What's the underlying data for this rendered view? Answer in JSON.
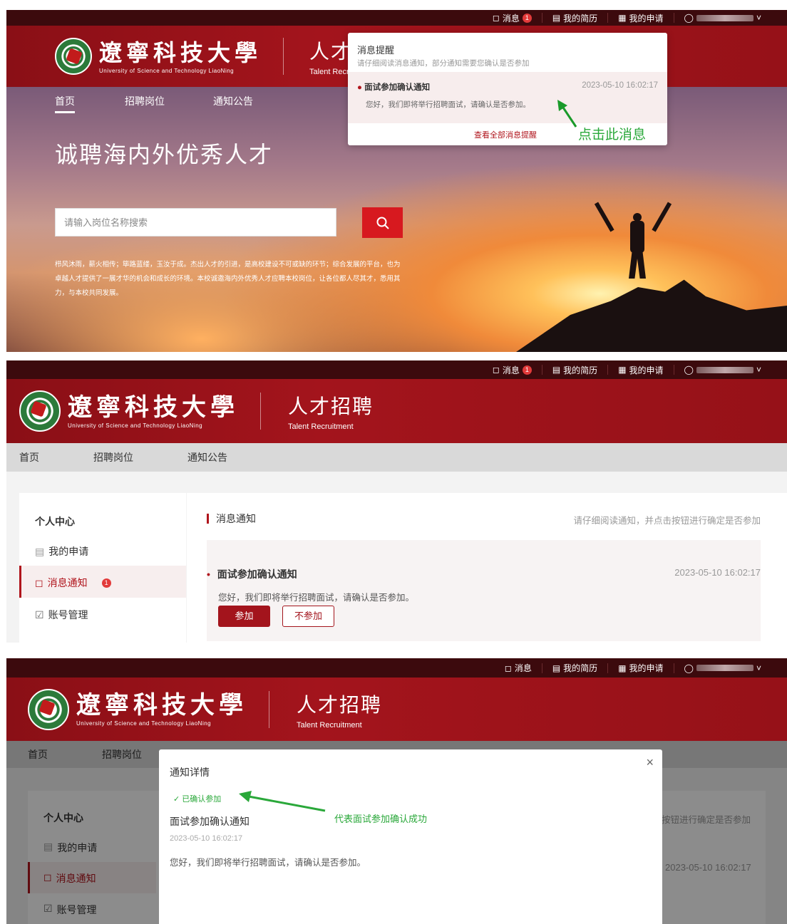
{
  "topbar": {
    "messages": "消息",
    "messages_badge": "1",
    "resume": "我的简历",
    "applications": "我的申请"
  },
  "brand": {
    "univ_cn": "遼寧科技大學",
    "univ_en": "University of Science and Technology LiaoNing",
    "recruit_cn": "人才招聘",
    "recruit_en": "Talent Recruitment"
  },
  "nav": {
    "home": "首页",
    "jobs": "招聘岗位",
    "notices": "通知公告"
  },
  "hero": {
    "title": "诚聘海内外优秀人才",
    "search_placeholder": "请输入岗位名称搜索",
    "desc": "栉风沐雨，薪火相传；筚路蓝缕，玉汝于成。杰出人才的引进，是高校建设不可或缺的环节；综合发展的平台，也为卓越人才提供了一展才华的机会和成长的环境。本校诚邀海内外优秀人才应聘本校岗位，让各位都人尽其才，悉用其力，与本校共同发展。"
  },
  "popup": {
    "title": "消息提醒",
    "subtitle": "请仔细阅读消息通知，部分通知需要您确认是否参加",
    "msg_title": "面试参加确认通知",
    "msg_time": "2023-05-10 16:02:17",
    "msg_body": "您好，我们即将举行招聘面试，请确认是否参加。",
    "view_all": "查看全部消息提醒"
  },
  "annotations": {
    "click_msg": "点击此消息",
    "confirm_success": "代表面试参加确认成功"
  },
  "sidebar": {
    "title": "个人中心",
    "items": [
      {
        "label": "我的申请"
      },
      {
        "label": "消息通知",
        "badge": "1"
      },
      {
        "label": "账号管理"
      }
    ]
  },
  "messages_page": {
    "heading": "消息通知",
    "hint": "请仔细阅读通知，并点击按钮进行确定是否参加",
    "card_title": "面试参加确认通知",
    "card_time": "2023-05-10 16:02:17",
    "card_body": "您好，我们即将举行招聘面试，请确认是否参加。",
    "btn_join": "参加",
    "btn_decline": "不参加"
  },
  "modal": {
    "title": "通知详情",
    "status": "已确认参加",
    "notice_title": "面试参加确认通知",
    "notice_time": "2023-05-10 16:02:17",
    "notice_body": "您好，我们即将举行招聘面试，请确认是否参加。"
  },
  "behind_modal": {
    "hint_tail": "按钮进行确定是否参加",
    "time": "2023-05-10 16:02:17"
  },
  "colors": {
    "brand": "#a3141c",
    "dark": "#3c0a0d",
    "green": "#2aa83a"
  }
}
